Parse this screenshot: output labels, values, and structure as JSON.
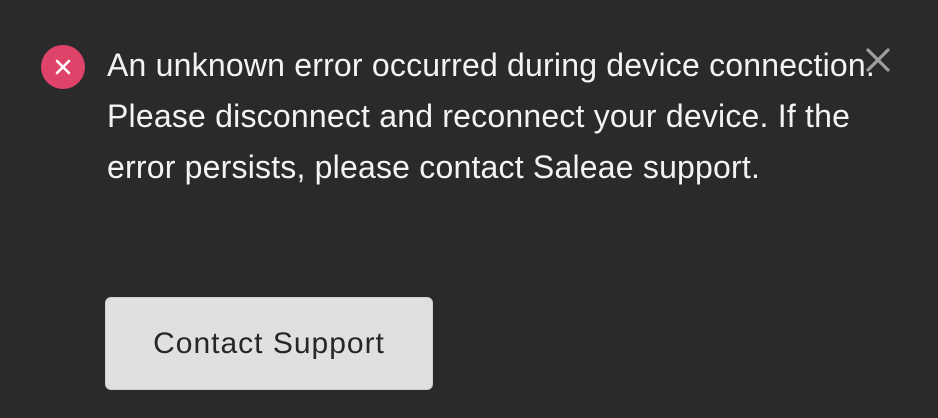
{
  "notification": {
    "severity": "error",
    "icon": "error-circle-icon",
    "message": "An unknown error occurred during device connection. Please disconnect and reconnect your device. If the error persists, please contact Saleae support.",
    "action_label": "Contact Support",
    "close_icon": "close-icon"
  },
  "colors": {
    "background": "#2a2a2c",
    "error_accent": "#e0436a",
    "text": "#f3f3f3",
    "button_background": "#e0e0e0",
    "button_text": "#262626",
    "close_icon": "#9e9e9e"
  }
}
